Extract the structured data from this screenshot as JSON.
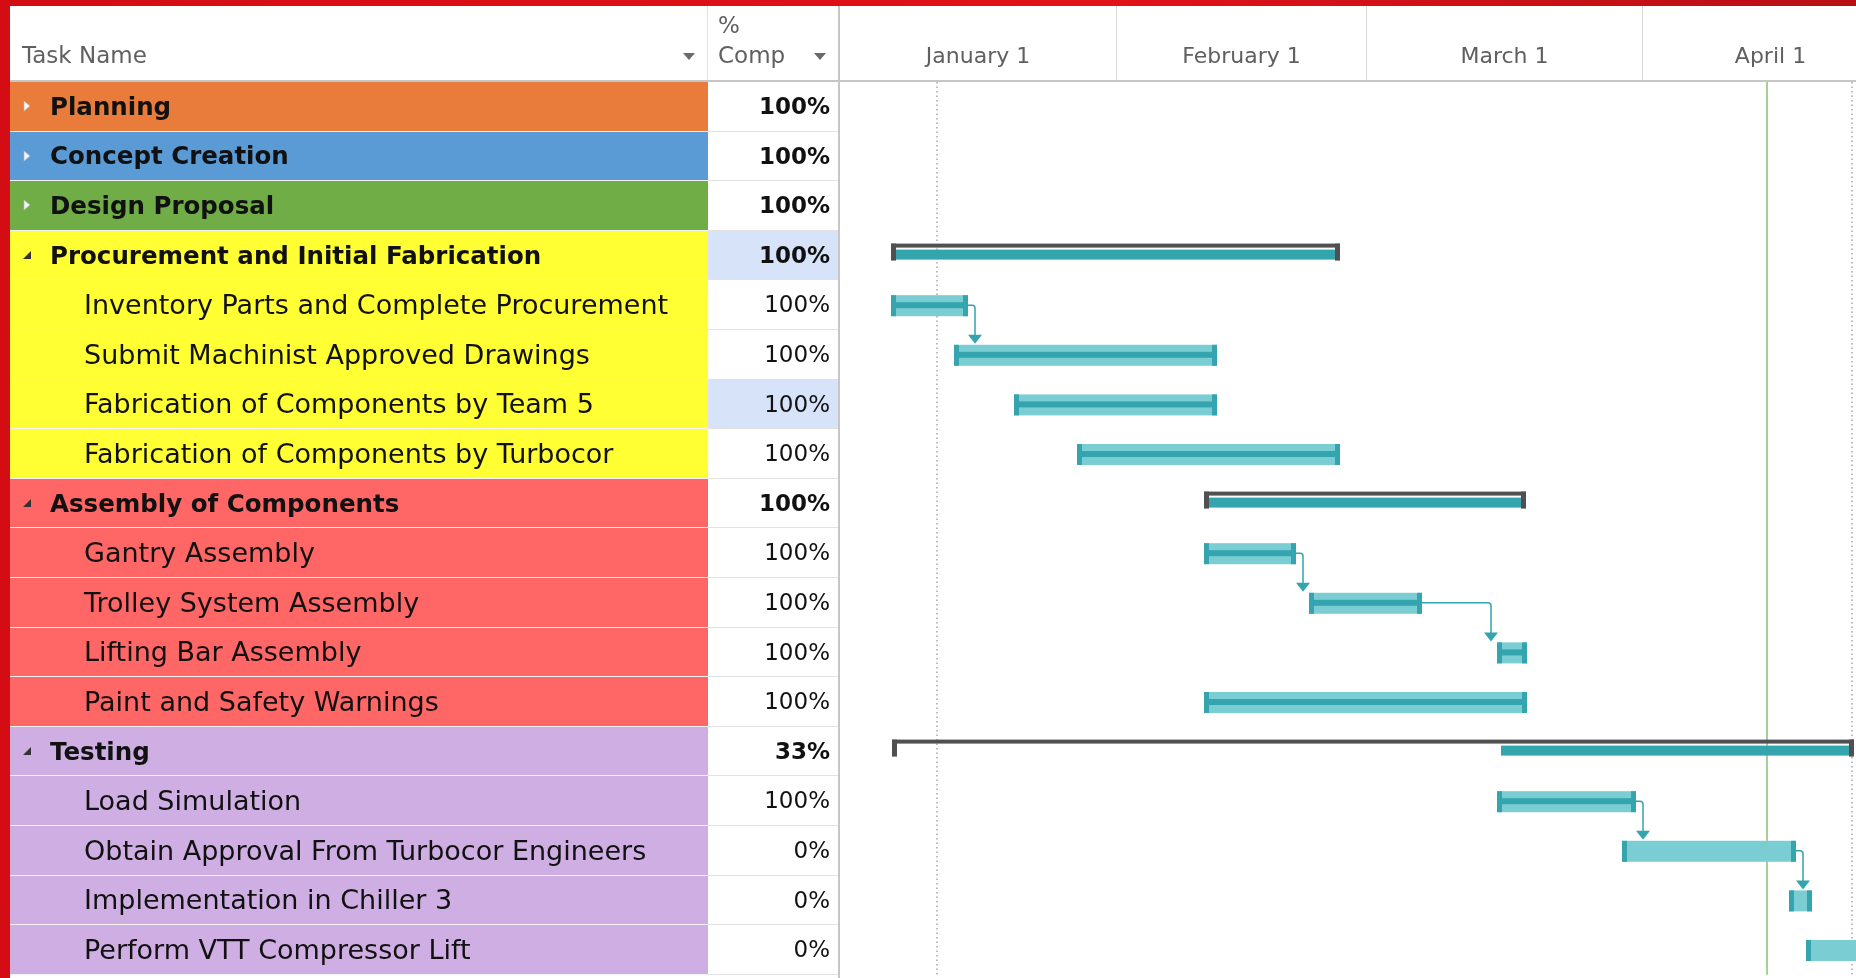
{
  "table": {
    "columns": [
      "Task Name",
      "% Comp"
    ],
    "tasks": [
      {
        "name": "Planning",
        "percent": "100%",
        "color": "#e97c3b",
        "expanded": false,
        "selected": false
      },
      {
        "name": "Concept Creation",
        "percent": "100%",
        "color": "#5b9bd5",
        "expanded": false,
        "selected": false
      },
      {
        "name": "Design Proposal",
        "percent": "100%",
        "color": "#70ad47",
        "expanded": false,
        "selected": false
      },
      {
        "name": "Procurement and Initial Fabrication",
        "percent": "100%",
        "color": "#ffff33",
        "expanded": true,
        "selected": true,
        "children": [
          {
            "name": "Inventory Parts and Complete Procurement",
            "percent": "100%",
            "selected": false
          },
          {
            "name": "Submit Machinist Approved Drawings",
            "percent": "100%",
            "selected": false
          },
          {
            "name": "Fabrication of Components by Team 5",
            "percent": "100%",
            "selected": true
          },
          {
            "name": "Fabrication of Components by Turbocor",
            "percent": "100%",
            "selected": false
          }
        ]
      },
      {
        "name": "Assembly of Components",
        "percent": "100%",
        "color": "#ff6666",
        "expanded": true,
        "selected": false,
        "children": [
          {
            "name": "Gantry Assembly",
            "percent": "100%",
            "selected": false
          },
          {
            "name": "Trolley System Assembly",
            "percent": "100%",
            "selected": false
          },
          {
            "name": "Lifting Bar Assembly",
            "percent": "100%",
            "selected": false
          },
          {
            "name": "Paint and Safety Warnings",
            "percent": "100%",
            "selected": false
          }
        ]
      },
      {
        "name": "Testing",
        "percent": "33%",
        "color": "#cfafe3",
        "expanded": true,
        "selected": false,
        "children": [
          {
            "name": "Load Simulation",
            "percent": "100%",
            "selected": false
          },
          {
            "name": "Obtain Approval From Turbocor Engineers",
            "percent": "0%",
            "selected": false
          },
          {
            "name": "Implementation in Chiller 3",
            "percent": "0%",
            "selected": false
          },
          {
            "name": "Perform VTT Compressor Lift",
            "percent": "0%",
            "selected": false
          }
        ]
      }
    ]
  },
  "timeline": {
    "labels": [
      "January 1",
      "February 1",
      "March 1",
      "April 1"
    ]
  }
}
